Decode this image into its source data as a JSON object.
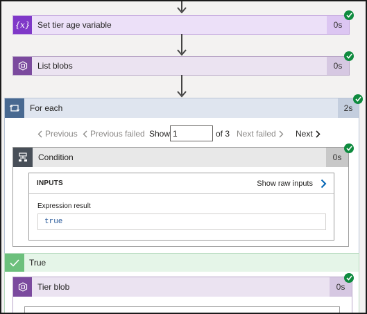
{
  "steps": {
    "set_variable": {
      "title": "Set tier age variable",
      "duration": "0s",
      "icon": "variable-icon",
      "glyph": "{x}"
    },
    "list_blobs": {
      "title": "List blobs",
      "duration": "0s",
      "icon": "blob-storage-icon"
    }
  },
  "foreach": {
    "title": "For each",
    "duration": "2s",
    "icon": "loop-icon",
    "pager": {
      "previous": "Previous",
      "previous_failed": "Previous failed",
      "show": "Show",
      "current": "1",
      "of_total": "of 3",
      "next_failed": "Next failed",
      "next": "Next"
    }
  },
  "condition": {
    "title": "Condition",
    "duration": "0s",
    "icon": "condition-icon",
    "inputs_label": "INPUTS",
    "show_raw": "Show raw inputs",
    "expression_label": "Expression result",
    "expression_value": "true"
  },
  "true_branch": {
    "title": "True",
    "icon": "checkmark-icon"
  },
  "tier_blob": {
    "title": "Tier blob",
    "duration": "0s",
    "icon": "blob-storage-icon"
  },
  "colors": {
    "success": "#0f8b3f",
    "variable": "#7f38c8",
    "storage": "#7b4a9e",
    "loop": "#486991",
    "condition": "#484f58",
    "true_branch": "#6cc07c"
  }
}
